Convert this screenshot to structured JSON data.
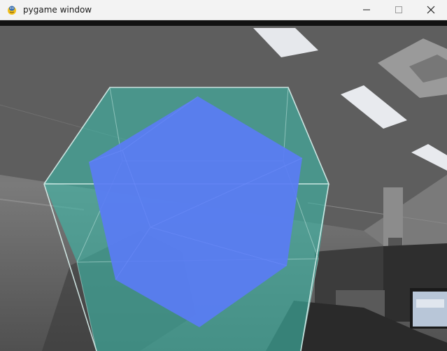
{
  "window": {
    "title": "pygame window",
    "app_icon": "pygame-snake-icon",
    "controls": {
      "minimize": "minimize-icon",
      "maximize": "maximize-icon",
      "close": "close-icon"
    }
  },
  "scene": {
    "background": "camera-feed-office-ceiling",
    "objects": [
      {
        "name": "wireframe-cube",
        "color": "#3fb8a8"
      },
      {
        "name": "polyhedron",
        "color": "#5a7cf5"
      }
    ]
  }
}
